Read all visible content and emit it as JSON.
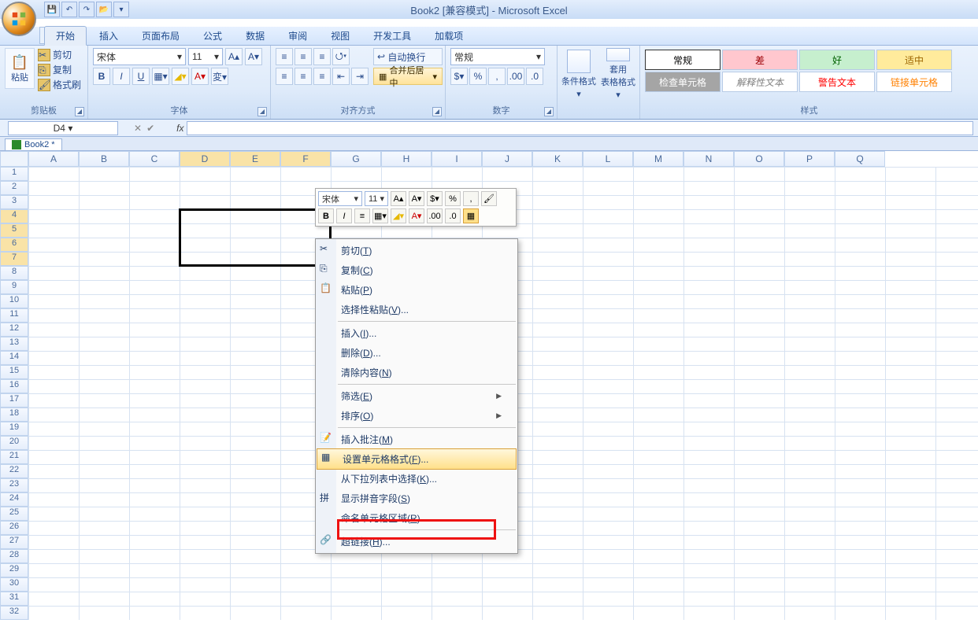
{
  "title": "Book2  [兼容模式] - Microsoft Excel",
  "qat": [
    "save",
    "undo",
    "redo",
    "open",
    "more"
  ],
  "tabs": [
    "开始",
    "插入",
    "页面布局",
    "公式",
    "数据",
    "审阅",
    "视图",
    "开发工具",
    "加载项"
  ],
  "active_tab": "开始",
  "clipboard": {
    "paste": "粘贴",
    "cut": "剪切",
    "copy": "复制",
    "format_painter": "格式刷",
    "label": "剪贴板"
  },
  "font": {
    "name": "宋体",
    "size": "11",
    "label": "字体"
  },
  "align": {
    "wrap": "自动换行",
    "merge": "合并后居中",
    "label": "对齐方式"
  },
  "number": {
    "format": "常规",
    "label": "数字"
  },
  "cond_format": "条件格式",
  "table_format": "套用\n表格格式",
  "styles": {
    "label": "样式",
    "cells": [
      {
        "text": "常规",
        "bg": "#ffffff",
        "fg": "#000",
        "border": "#333"
      },
      {
        "text": "差",
        "bg": "#ffc7ce",
        "fg": "#9c0006"
      },
      {
        "text": "好",
        "bg": "#c6efce",
        "fg": "#006100"
      },
      {
        "text": "适中",
        "bg": "#ffeb9c",
        "fg": "#9c6500"
      },
      {
        "text": "检查单元格",
        "bg": "#a5a5a5",
        "fg": "#ffffff"
      },
      {
        "text": "解释性文本",
        "bg": "#ffffff",
        "fg": "#808080",
        "italic": true
      },
      {
        "text": "警告文本",
        "bg": "#ffffff",
        "fg": "#ff0000"
      },
      {
        "text": "链接单元格",
        "bg": "#ffffff",
        "fg": "#ff8001"
      }
    ]
  },
  "namebox": "D4",
  "file_tab": "Book2 *",
  "columns": [
    "A",
    "B",
    "C",
    "D",
    "E",
    "F",
    "G",
    "H",
    "I",
    "J",
    "K",
    "L",
    "M",
    "N",
    "O",
    "P",
    "Q"
  ],
  "sel_cols": [
    "D",
    "E",
    "F"
  ],
  "rows_count": 32,
  "sel_rows": [
    4,
    5,
    6,
    7
  ],
  "mini": {
    "font": "宋体",
    "size": "11"
  },
  "context_menu": [
    {
      "label": "剪切",
      "key": "T",
      "icon": "cut"
    },
    {
      "label": "复制",
      "key": "C",
      "icon": "copy"
    },
    {
      "label": "粘贴",
      "key": "P",
      "icon": "paste"
    },
    {
      "label": "选择性粘贴",
      "key": "V",
      "ell": true
    },
    {
      "sep": true
    },
    {
      "label": "插入",
      "key": "I",
      "ell": true
    },
    {
      "label": "删除",
      "key": "D",
      "ell": true
    },
    {
      "label": "清除内容",
      "key": "N"
    },
    {
      "sep": true
    },
    {
      "label": "筛选",
      "key": "E",
      "sub": true
    },
    {
      "label": "排序",
      "key": "O",
      "sub": true
    },
    {
      "sep": true
    },
    {
      "label": "插入批注",
      "key": "M",
      "icon": "comment"
    },
    {
      "label": "设置单元格格式",
      "key": "F",
      "ell": true,
      "icon": "format",
      "highlight": true
    },
    {
      "label": "从下拉列表中选择",
      "key": "K",
      "ell": true
    },
    {
      "label": "显示拼音字段",
      "key": "S",
      "icon": "pinyin"
    },
    {
      "label": "命名单元格区域",
      "key": "R",
      "ell": true
    },
    {
      "sep": true
    },
    {
      "label": "超链接",
      "key": "H",
      "ell": true,
      "icon": "link"
    }
  ]
}
